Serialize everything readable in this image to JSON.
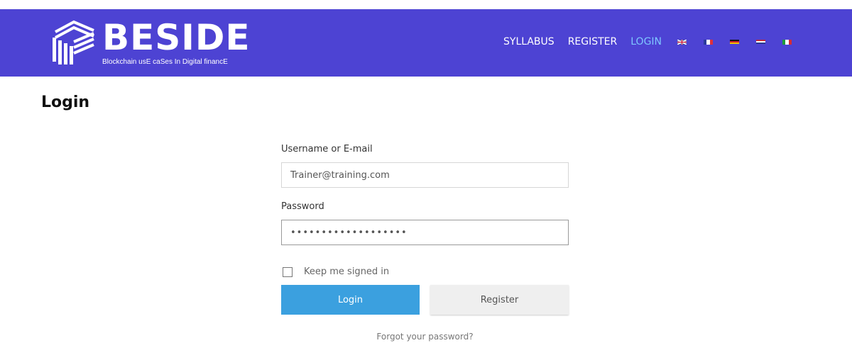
{
  "brand": {
    "name": "BESIDE",
    "tagline": "Blockchain usE caSes In Digital financE",
    "header_color": "#4d43d3"
  },
  "nav": {
    "items": [
      {
        "label": "SYLLABUS",
        "active": false
      },
      {
        "label": "REGISTER",
        "active": false
      },
      {
        "label": "LOGIN",
        "active": true
      }
    ],
    "active_color": "#7ec6ff",
    "flags": [
      "uk-flag-icon",
      "france-flag-icon",
      "germany-flag-icon",
      "netherlands-flag-icon",
      "italy-flag-icon"
    ]
  },
  "page": {
    "title": "Login"
  },
  "form": {
    "username_label": "Username or E-mail",
    "username_value": "Trainer@training.com",
    "password_label": "Password",
    "password_value": "•••••••••••••••••••",
    "keep_signed_label": "Keep me signed in",
    "keep_signed_checked": false,
    "login_button": "Login",
    "register_button": "Register",
    "forgot_link": "Forgot your password?",
    "login_button_color": "#3ba0df"
  }
}
